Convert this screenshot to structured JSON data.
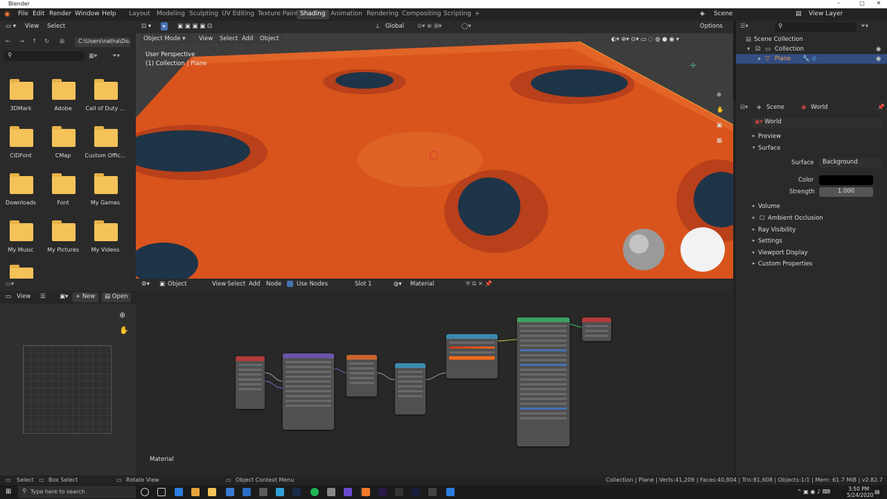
{
  "window": {
    "title": "Blender"
  },
  "menubar": {
    "items": [
      "File",
      "Edit",
      "Render",
      "Window",
      "Help"
    ]
  },
  "workspaces": {
    "tabs": [
      "Layout",
      "Modeling",
      "Sculpting",
      "UV Editing",
      "Texture Paint",
      "Shading",
      "Animation",
      "Rendering",
      "Compositing",
      "Scripting"
    ],
    "active": "Shading",
    "add": "+"
  },
  "scene": {
    "label": "Scene",
    "view_layer": "View Layer"
  },
  "filebrowser": {
    "header": {
      "view": "View",
      "select": "Select"
    },
    "path": "C:\\Users\\natha\\Do...",
    "folders": [
      "3DMark",
      "Adobe",
      "Call of Duty ...",
      "CIDFont",
      "CMap",
      "Custom Offic...",
      "Downloads",
      "Font",
      "My Games",
      "My Music",
      "My Pictures",
      "My Videos"
    ]
  },
  "viewport": {
    "mode": "Object Mode",
    "menu": [
      "View",
      "Select",
      "Add",
      "Object"
    ],
    "orientation": "Global",
    "options": "Options",
    "overlay_title": "User Perspective",
    "overlay_sub": "(1) Collection | Plane"
  },
  "image_editor": {
    "view": "View",
    "new": "New",
    "open": "Open"
  },
  "node_editor": {
    "editor_type": "Object",
    "menu": [
      "View",
      "Select",
      "Add",
      "Node"
    ],
    "use_nodes": "Use Nodes",
    "slot": "Slot 1",
    "material": "Material",
    "footer_label": "Material"
  },
  "outliner": {
    "scene_collection": "Scene Collection",
    "collection": "Collection",
    "plane": "Plane"
  },
  "properties": {
    "tabs": {
      "scene": "Scene",
      "world": "World"
    },
    "world_name": "World",
    "panels": [
      "Preview",
      "Surface"
    ],
    "surface_label": "Surface",
    "surface_value": "Background",
    "color_label": "Color",
    "color_value": "#000000",
    "strength_label": "Strength",
    "strength_value": "1.000",
    "sections": [
      "Volume",
      "Ambient Occlusion",
      "Ray Visibility",
      "Settings",
      "Viewport Display",
      "Custom Properties"
    ]
  },
  "statusbar": {
    "select": "Select",
    "box_select": "Box Select",
    "rotate": "Rotate View",
    "context": "Object Context Menu",
    "stats": "Collection | Plane | Verts:41,209 | Faces:40,804 | Tris:81,608 | Objects:1/1 | Mem: 61.7 MiB | v2.82.7"
  },
  "taskbar": {
    "search_placeholder": "Type here to search",
    "time": "3:50 PM",
    "date": "5/24/2020"
  },
  "colors": {
    "accent": "#4772b3",
    "active_row": "#334d80",
    "terrain": "#d9541c",
    "folder": "#f4c259"
  }
}
